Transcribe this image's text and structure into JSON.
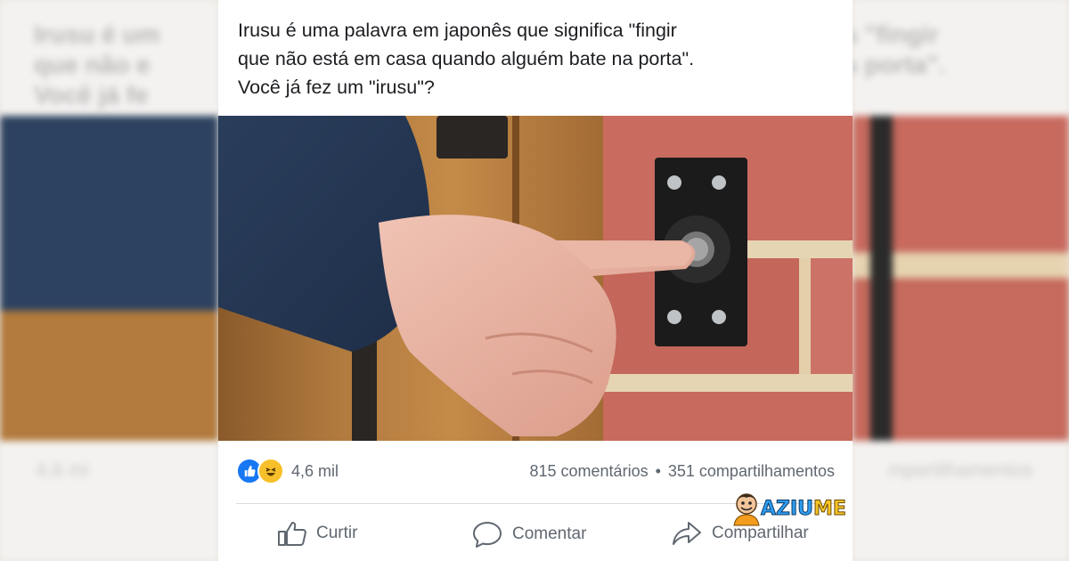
{
  "post": {
    "text_line1": "Irusu é uma palavra em japonês que significa \"fingir",
    "text_line2": "que não está em casa quando alguém bate na porta\".",
    "text_line3": "Você já fez um \"irusu\"?"
  },
  "stats": {
    "reactions_count": "4,6 mil",
    "comments": "815 comentários",
    "separator": "•",
    "shares": "351 compartilhamentos"
  },
  "actions": {
    "like": "Curtir",
    "comment": "Comentar",
    "share": "Compartilhar"
  },
  "background": {
    "left_text_line1": "Irusu é um",
    "left_text_line2": "que não e",
    "left_text_line3": "Você já fe",
    "right_text_line1": "a \"fingir",
    "right_text_line2": "a porta\".",
    "left_foot": "4,6 mi",
    "right_foot": "mpartilhamentos"
  },
  "watermark": {
    "brand_part1": "AZIU",
    "brand_part2": "ME"
  },
  "colors": {
    "like_blue": "#1877f2",
    "haha_yellow": "#f7c02a",
    "text_gray": "#606770",
    "text_dark": "#1c1e21"
  },
  "icons": {
    "like_reaction": "thumbs-up-icon",
    "haha_reaction": "laughing-face-icon",
    "like_action": "thumbs-up-outline-icon",
    "comment_action": "speech-bubble-icon",
    "share_action": "share-arrow-icon"
  }
}
